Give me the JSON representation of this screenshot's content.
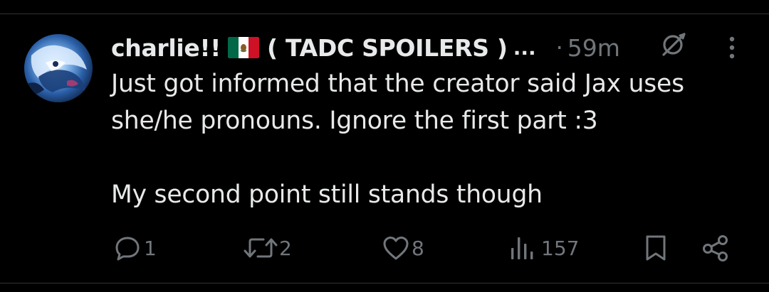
{
  "post": {
    "author": {
      "display_name": "charlie!!",
      "flag_icon": "mexico-flag-icon",
      "name_suffix": "( TADC SPOILERS )",
      "truncation": "...",
      "avatar_icon": "avatar-image"
    },
    "separator": "·",
    "time": "59m",
    "text": "Just got informed that the creator said Jax uses she/he pronouns. Ignore the first part :3\n\nMy second point still stands though",
    "actions": {
      "replies": "1",
      "reposts": "2",
      "likes": "8",
      "views": "157"
    },
    "icons": {
      "grok": "grok-icon",
      "more": "more-icon",
      "reply": "reply-icon",
      "repost": "repost-icon",
      "like": "heart-icon",
      "views": "views-icon",
      "bookmark": "bookmark-icon",
      "share": "share-icon"
    }
  },
  "colors": {
    "background": "#000000",
    "text_primary": "#e7e9ea",
    "text_secondary": "#71767b",
    "divider": "#2f3336"
  }
}
